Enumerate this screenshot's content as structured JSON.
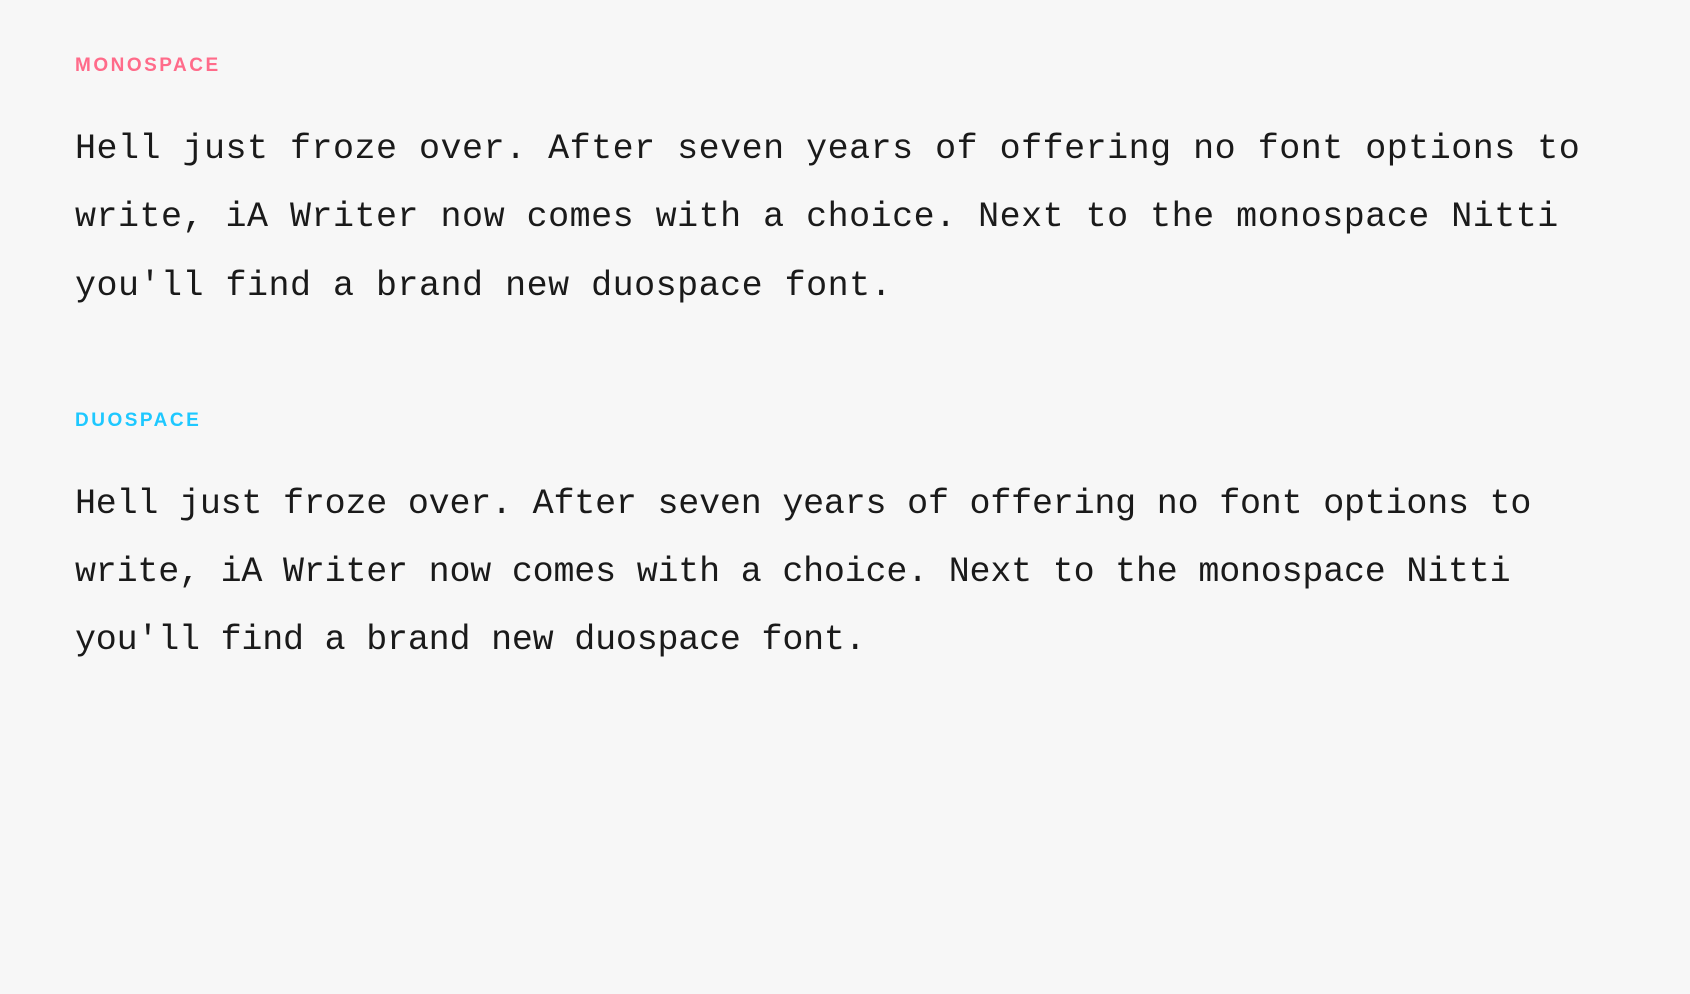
{
  "sections": {
    "monospace": {
      "label": "MONOSPACE",
      "body": "Hell just froze over. After seven years of offering no font options to write, iA Writer now comes with a choice. Next to the monospace Nitti you'll find a brand new duospace font."
    },
    "duospace": {
      "label": "DUOSPACE",
      "body": "Hell just froze over. After seven years of offering no font options to write, iA Writer now comes with a choice. Next to the monospace Nitti you'll find a brand new duospace font."
    }
  },
  "colors": {
    "monospace_label": "#ff6b8a",
    "duospace_label": "#1ec8ff",
    "background": "#f7f7f7",
    "text": "#1a1a1a"
  }
}
